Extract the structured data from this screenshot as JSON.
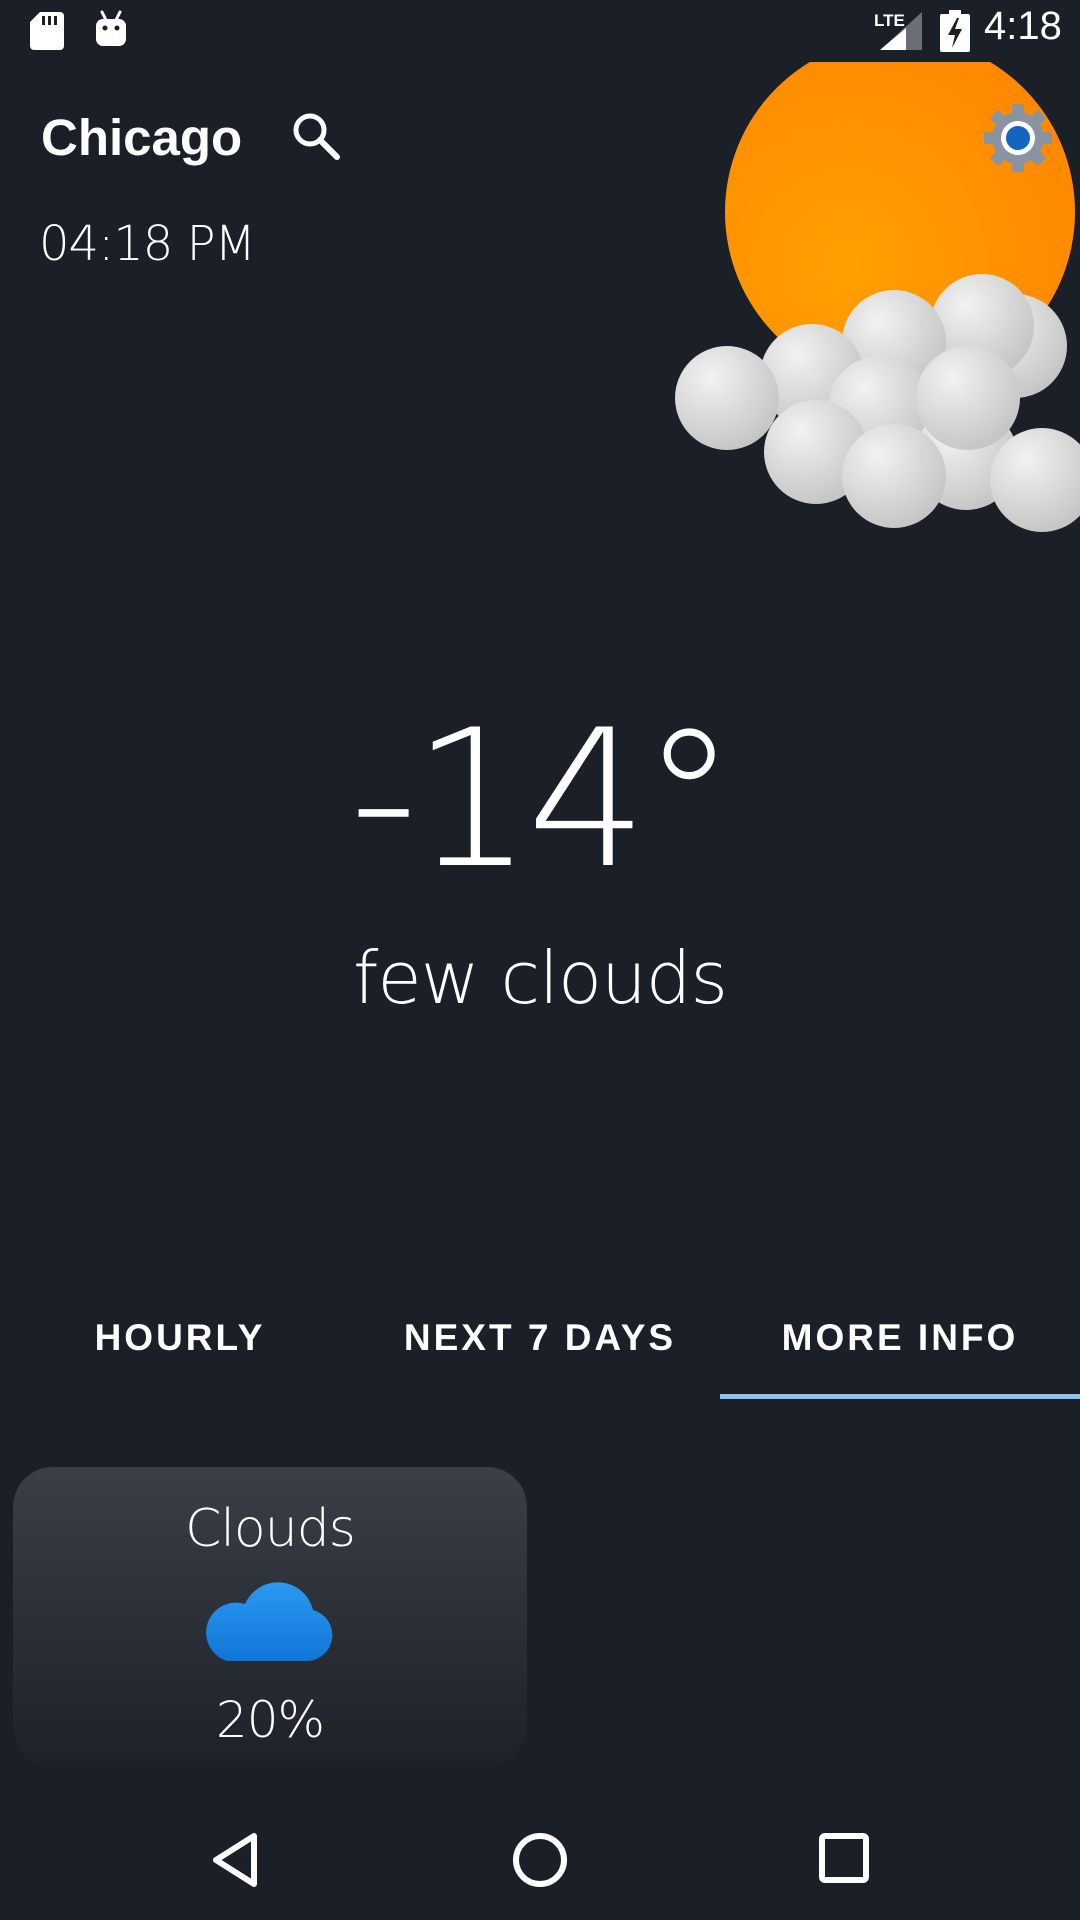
{
  "status_bar": {
    "network_label": "LTE",
    "time": "4:18",
    "icons": [
      "sd-card-icon",
      "android-icon",
      "signal-icon",
      "battery-charging-icon"
    ]
  },
  "header": {
    "city": "Chicago",
    "local_time": "04:18 PM",
    "icons": [
      "search-icon",
      "settings-icon"
    ]
  },
  "current": {
    "temperature": "-14°",
    "description": "few clouds",
    "illustration": "sun-behind-clouds-icon"
  },
  "tabs": [
    {
      "label": "HOURLY",
      "selected": false
    },
    {
      "label": "NEXT 7 DAYS",
      "selected": false
    },
    {
      "label": "MORE INFO",
      "selected": true
    }
  ],
  "info_cards": [
    {
      "title": "Clouds",
      "icon": "cloud-icon",
      "value": "20%"
    }
  ],
  "navigation": {
    "icons": [
      "back-icon",
      "home-icon",
      "recent-apps-icon"
    ]
  },
  "colors": {
    "background": "#1b1f27",
    "tab_indicator": "#8fc2ee",
    "sun": "#ff8c00",
    "cloud_icon": "#1a86e6"
  }
}
